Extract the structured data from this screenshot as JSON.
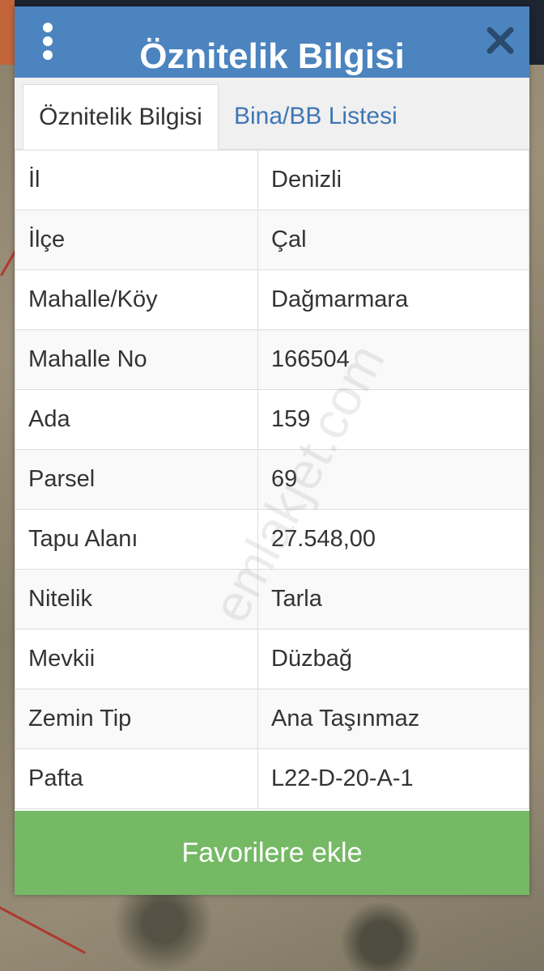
{
  "dialog": {
    "title": "Öznitelik Bilgisi",
    "header_color": "#4b84bf"
  },
  "tabs": [
    {
      "label": "Öznitelik Bilgisi",
      "active": true
    },
    {
      "label": "Bina/BB Listesi",
      "active": false
    }
  ],
  "attributes": [
    {
      "key": "İl",
      "value": "Denizli"
    },
    {
      "key": "İlçe",
      "value": "Çal"
    },
    {
      "key": "Mahalle/Köy",
      "value": "Dağmarmara"
    },
    {
      "key": "Mahalle No",
      "value": "166504"
    },
    {
      "key": "Ada",
      "value": "159"
    },
    {
      "key": "Parsel",
      "value": "69"
    },
    {
      "key": "Tapu Alanı",
      "value": "27.548,00"
    },
    {
      "key": "Nitelik",
      "value": "Tarla"
    },
    {
      "key": "Mevkii",
      "value": "Düzbağ"
    },
    {
      "key": "Zemin Tip",
      "value": "Ana Taşınmaz"
    },
    {
      "key": "Pafta",
      "value": "L22-D-20-A-1"
    }
  ],
  "favorite_button": {
    "label": "Favorilere ekle",
    "color": "#75b965"
  },
  "watermark": "emlakjet.com",
  "icons": {
    "menu": "vertical-dots-icon",
    "close": "close-icon"
  }
}
